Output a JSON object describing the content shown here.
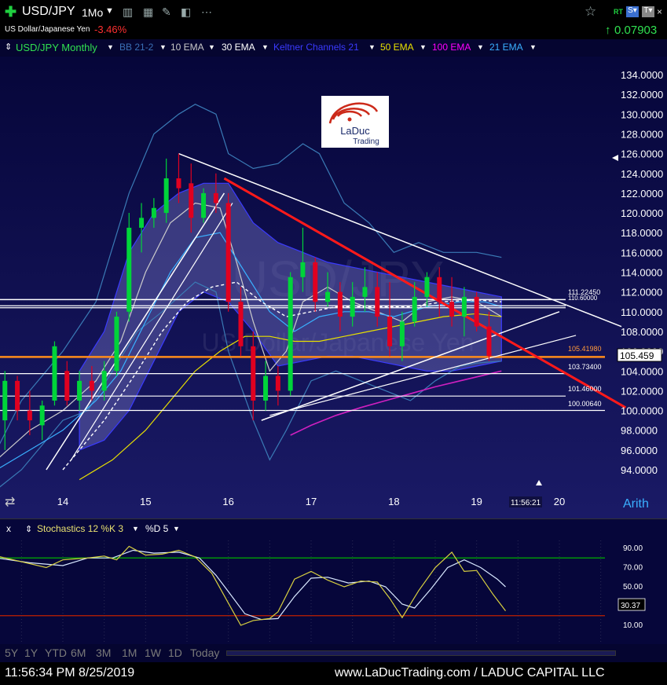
{
  "header": {
    "plus_icon": "plus-icon",
    "symbol": "USD/JPY",
    "interval": "1Mo",
    "symbol_desc": "US Dollar/Japanese Yen",
    "change_pct": "-3.46%",
    "change_abs": "0.07903",
    "rt_badge": "RT"
  },
  "indicators": {
    "main_label": "USD/JPY Monthly",
    "items": [
      {
        "label": "BB 21-2",
        "color": "#3a6fb5"
      },
      {
        "label": "10 EMA",
        "color": "#c8c8c8"
      },
      {
        "label": "30 EMA",
        "color": "#ffffff"
      },
      {
        "label": "Keltner Channels 21",
        "color": "#3a3aff"
      },
      {
        "label": "50 EMA",
        "color": "#e8e000"
      },
      {
        "label": "100 EMA",
        "color": "#ff00ff"
      },
      {
        "label": "21 EMA",
        "color": "#3ab0ff"
      }
    ]
  },
  "watermark": {
    "symbol": "USD/JPY",
    "desc": "US Dollar/Japanese Yen"
  },
  "logo": {
    "line1": "LaDuc",
    "line2": "Trading"
  },
  "levels": {
    "l1": "111.22450",
    "l2": "110.60000",
    "orange": "105.41980",
    "l3": "103.73400",
    "l4": "101.46000",
    "l5": "100.00640",
    "current_price": "105.459"
  },
  "chart_data": {
    "type": "candlestick",
    "x_ticks": [
      "14",
      "15",
      "16",
      "17",
      "18",
      "19",
      "20"
    ],
    "y_ticks": [
      "134.0000",
      "132.0000",
      "130.0000",
      "128.0000",
      "126.0000",
      "124.0000",
      "122.0000",
      "120.0000",
      "118.0000",
      "116.0000",
      "114.0000",
      "112.0000",
      "110.0000",
      "108.0000",
      "106.0000",
      "104.0000",
      "102.0000",
      "100.0000",
      "98.0000",
      "96.0000",
      "94.0000"
    ],
    "ylim": [
      92.5,
      135.3
    ],
    "scale_label": "Arith",
    "time_label": "11:56:21",
    "candles": [
      {
        "t": 13.3,
        "o": 99,
        "h": 104,
        "l": 96,
        "c": 103
      },
      {
        "t": 13.45,
        "o": 103,
        "h": 103.5,
        "l": 99,
        "c": 100
      },
      {
        "t": 13.6,
        "o": 100,
        "h": 102,
        "l": 97.5,
        "c": 99
      },
      {
        "t": 13.75,
        "o": 98.5,
        "h": 101,
        "l": 97,
        "c": 100.5
      },
      {
        "t": 13.9,
        "o": 101,
        "h": 107,
        "l": 100.5,
        "c": 106.5
      },
      {
        "t": 14.05,
        "o": 104,
        "h": 105,
        "l": 100.5,
        "c": 101
      },
      {
        "t": 14.2,
        "o": 101,
        "h": 104,
        "l": 100,
        "c": 103
      },
      {
        "t": 14.35,
        "o": 103,
        "h": 104.5,
        "l": 101,
        "c": 102
      },
      {
        "t": 14.5,
        "o": 102,
        "h": 105,
        "l": 101,
        "c": 104
      },
      {
        "t": 14.65,
        "o": 104,
        "h": 110,
        "l": 103.5,
        "c": 109.5
      },
      {
        "t": 14.8,
        "o": 110,
        "h": 120,
        "l": 109,
        "c": 118.5
      },
      {
        "t": 14.95,
        "o": 118.5,
        "h": 121,
        "l": 116,
        "c": 119.5
      },
      {
        "t": 15.1,
        "o": 119.5,
        "h": 121.5,
        "l": 118.5,
        "c": 120.5
      },
      {
        "t": 15.25,
        "o": 120,
        "h": 125.5,
        "l": 119,
        "c": 123.5
      },
      {
        "t": 15.4,
        "o": 123.5,
        "h": 126,
        "l": 121,
        "c": 122.5
      },
      {
        "t": 15.55,
        "o": 123,
        "h": 125,
        "l": 118,
        "c": 119.5
      },
      {
        "t": 15.7,
        "o": 119.5,
        "h": 122.5,
        "l": 119,
        "c": 122
      },
      {
        "t": 15.85,
        "o": 122,
        "h": 124,
        "l": 120,
        "c": 121
      },
      {
        "t": 16.0,
        "o": 121,
        "h": 122,
        "l": 110,
        "c": 111
      },
      {
        "t": 16.15,
        "o": 111,
        "h": 112.5,
        "l": 105.5,
        "c": 106.5
      },
      {
        "t": 16.3,
        "o": 106.5,
        "h": 108,
        "l": 99,
        "c": 101
      },
      {
        "t": 16.45,
        "o": 101,
        "h": 105,
        "l": 100,
        "c": 103.5
      },
      {
        "t": 16.6,
        "o": 103.5,
        "h": 104.5,
        "l": 100.5,
        "c": 102
      },
      {
        "t": 16.75,
        "o": 102,
        "h": 114,
        "l": 101.5,
        "c": 113.5
      },
      {
        "t": 16.9,
        "o": 113.5,
        "h": 118.5,
        "l": 112,
        "c": 115
      },
      {
        "t": 17.05,
        "o": 115,
        "h": 115.5,
        "l": 110,
        "c": 111
      },
      {
        "t": 17.2,
        "o": 111,
        "h": 114,
        "l": 110.5,
        "c": 112
      },
      {
        "t": 17.35,
        "o": 112,
        "h": 113,
        "l": 108,
        "c": 109.5
      },
      {
        "t": 17.5,
        "o": 109.5,
        "h": 113,
        "l": 108.5,
        "c": 111.5
      },
      {
        "t": 17.65,
        "o": 111.5,
        "h": 114.5,
        "l": 110,
        "c": 112.5
      },
      {
        "t": 17.8,
        "o": 112.5,
        "h": 114,
        "l": 108.5,
        "c": 109.5
      },
      {
        "t": 17.95,
        "o": 109.5,
        "h": 113,
        "l": 105.5,
        "c": 106.5
      },
      {
        "t": 18.1,
        "o": 106.5,
        "h": 110,
        "l": 105,
        "c": 109
      },
      {
        "t": 18.25,
        "o": 109,
        "h": 113,
        "l": 108.5,
        "c": 111.5
      },
      {
        "t": 18.4,
        "o": 111.5,
        "h": 114,
        "l": 110.5,
        "c": 113.5
      },
      {
        "t": 18.55,
        "o": 113.5,
        "h": 114.5,
        "l": 109.5,
        "c": 111
      },
      {
        "t": 18.7,
        "o": 111,
        "h": 113.5,
        "l": 108.5,
        "c": 109.5
      },
      {
        "t": 18.85,
        "o": 109.5,
        "h": 112.5,
        "l": 107.5,
        "c": 111.5
      },
      {
        "t": 19.0,
        "o": 111.5,
        "h": 112,
        "l": 108,
        "c": 108.5
      },
      {
        "t": 19.15,
        "o": 108.5,
        "h": 110,
        "l": 105,
        "c": 105.5
      }
    ]
  },
  "stoch": {
    "label": "Stochastics 12 %K 3",
    "d_label": "%D 5",
    "ticks": [
      "90.00",
      "70.00",
      "50.00",
      "30.37",
      "10.00"
    ],
    "upper_line": 80,
    "lower_line": 20,
    "k": [
      [
        13.2,
        82
      ],
      [
        13.5,
        76
      ],
      [
        13.8,
        70
      ],
      [
        14.0,
        78
      ],
      [
        14.3,
        80
      ],
      [
        14.5,
        82
      ],
      [
        14.65,
        78
      ],
      [
        14.8,
        92
      ],
      [
        15.0,
        83
      ],
      [
        15.2,
        84
      ],
      [
        15.4,
        88
      ],
      [
        15.6,
        81
      ],
      [
        15.8,
        64
      ],
      [
        16.0,
        33
      ],
      [
        16.15,
        10
      ],
      [
        16.3,
        15
      ],
      [
        16.5,
        17
      ],
      [
        16.6,
        24
      ],
      [
        16.8,
        58
      ],
      [
        17.0,
        66
      ],
      [
        17.2,
        57
      ],
      [
        17.4,
        50
      ],
      [
        17.6,
        56
      ],
      [
        17.8,
        55
      ],
      [
        17.95,
        38
      ],
      [
        18.1,
        18
      ],
      [
        18.3,
        46
      ],
      [
        18.5,
        70
      ],
      [
        18.7,
        86
      ],
      [
        18.85,
        66
      ],
      [
        19.0,
        67
      ],
      [
        19.2,
        42
      ],
      [
        19.35,
        25
      ]
    ],
    "d": [
      [
        13.2,
        80
      ],
      [
        13.6,
        75
      ],
      [
        14.0,
        72
      ],
      [
        14.3,
        80
      ],
      [
        14.6,
        80
      ],
      [
        14.85,
        88
      ],
      [
        15.1,
        85
      ],
      [
        15.4,
        86
      ],
      [
        15.65,
        80
      ],
      [
        15.85,
        62
      ],
      [
        16.0,
        45
      ],
      [
        16.2,
        22
      ],
      [
        16.4,
        16
      ],
      [
        16.6,
        17
      ],
      [
        16.8,
        40
      ],
      [
        17.0,
        59
      ],
      [
        17.2,
        60
      ],
      [
        17.45,
        54
      ],
      [
        17.7,
        56
      ],
      [
        17.9,
        50
      ],
      [
        18.1,
        32
      ],
      [
        18.25,
        28
      ],
      [
        18.45,
        48
      ],
      [
        18.65,
        70
      ],
      [
        18.85,
        78
      ],
      [
        19.05,
        70
      ],
      [
        19.25,
        58
      ],
      [
        19.35,
        50
      ]
    ]
  },
  "range_buttons": [
    "5Y",
    "1Y",
    "YTD",
    "6M",
    "3M",
    "1M",
    "1W",
    "1D",
    "Today"
  ],
  "footer": {
    "datetime": "11:56:34 PM 8/25/2019",
    "website": "www.LaDucTrading.com / LADUC CAPITAL LLC"
  },
  "colors": {
    "up": "#00d43a",
    "down": "#e00020",
    "trendline_red": "#ff1a1a",
    "orange_level": "#ff8c1a",
    "stoch_k": "#d8d040",
    "stoch_d": "#d8e8ff",
    "stoch_upper": "#00b000",
    "stoch_lower": "#c02000"
  }
}
